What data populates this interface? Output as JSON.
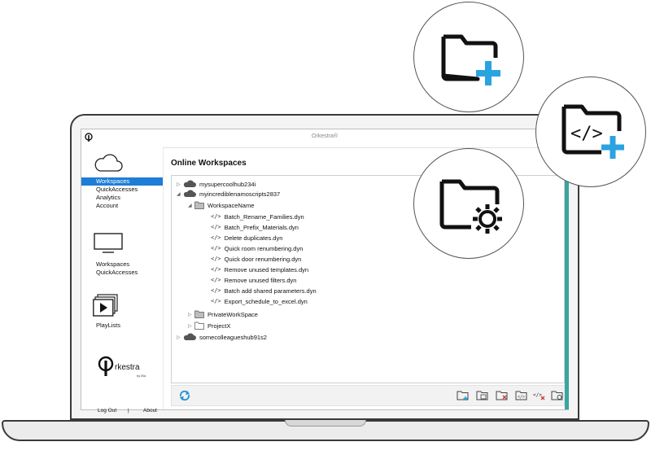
{
  "app": {
    "title": "Orkestra®"
  },
  "sidebar": {
    "groups": [
      {
        "items": [
          {
            "label": "Workspaces",
            "active": true
          },
          {
            "label": "QuickAccesses",
            "active": false
          },
          {
            "label": "Analytics",
            "active": false
          },
          {
            "label": "Account",
            "active": false
          }
        ]
      },
      {
        "items": [
          {
            "label": "Workspaces"
          },
          {
            "label": "QuickAccesses"
          }
        ]
      },
      {
        "items": [
          {
            "label": "PlayLists"
          }
        ]
      }
    ],
    "brand": {
      "name": "rkestra",
      "tagline": "by iBa"
    },
    "footer": {
      "logout": "Log Out",
      "separator": "|",
      "about": "About"
    }
  },
  "main": {
    "title": "Online Workspaces",
    "tree": {
      "hub1": "mysupercoolhub234i",
      "hub2": "myincrediblenamoscripts2837",
      "workspace": "WorkspaceName",
      "scripts": [
        "Batch_Rename_Families.dyn",
        "Batch_Prefix_Materials.dyn",
        "Delete duplicates.dyn",
        "Quick room renumbering.dyn",
        "Quick door renumbering.dyn",
        "Remove unused templates.dyn",
        "Remove unused filters.dyn",
        "Batch add shared parameters.dyn",
        "Export_schedule_to_excel.dyn"
      ],
      "private_ws": "PrivateWorkSpace",
      "project": "ProjectX",
      "hub3": "somecolleagueshub91s2"
    },
    "code_icon": "</>"
  },
  "icons": {
    "accent": "#2aa3e0",
    "active_color": "#1e7dd7",
    "circles": [
      "add-folder-icon",
      "add-script-folder-icon",
      "folder-settings-icon"
    ]
  }
}
